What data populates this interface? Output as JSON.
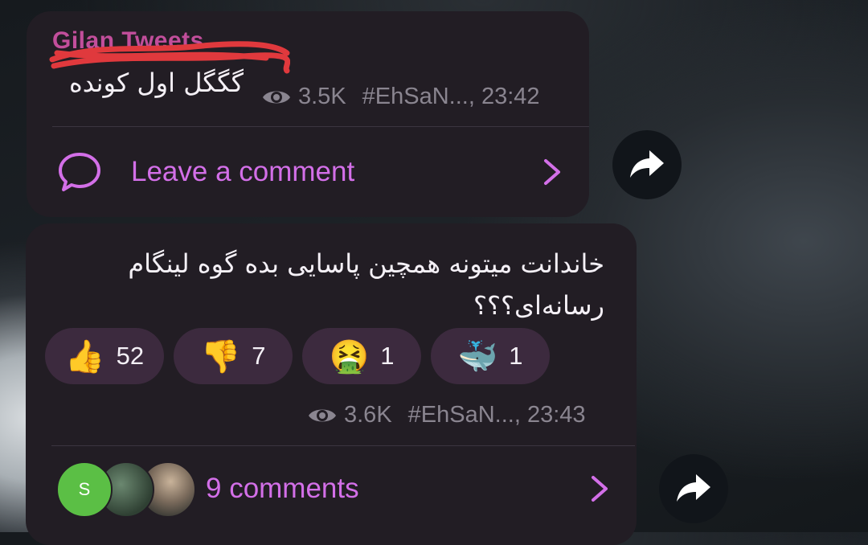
{
  "message1": {
    "channel_name": "Gilan Tweets",
    "text": "گگگل اول کونده",
    "views": "3.5K",
    "signature": "#EhSaN..., 23:42",
    "comment_label": "Leave a comment"
  },
  "message2": {
    "text": "خاندانت میتونه همچین پاسایی بده گوه لینگام رسانه‌ای؟؟؟",
    "reactions": [
      {
        "emoji": "👍",
        "count": "52"
      },
      {
        "emoji": "👎",
        "count": "7"
      },
      {
        "emoji": "🤮",
        "count": "1"
      },
      {
        "emoji": "🐳",
        "count": "1"
      }
    ],
    "views": "3.6K",
    "signature": "#EhSaN..., 23:43",
    "avatar_initial": "S",
    "comment_label": "9 comments"
  },
  "colors": {
    "bubble": "#221d24",
    "accent": "#d36fe8",
    "meta": "#8a8590",
    "reaction_bg": "#3c2a3e"
  }
}
